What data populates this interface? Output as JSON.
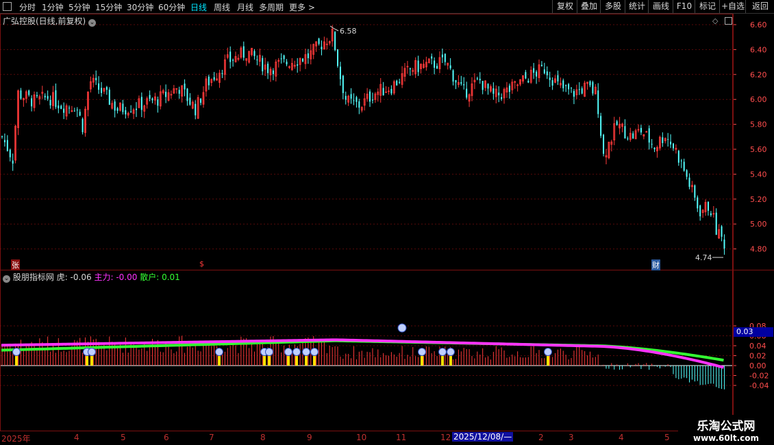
{
  "toolbar": {
    "periods": [
      "分时",
      "1分钟",
      "5分钟",
      "15分钟",
      "30分钟",
      "60分钟",
      "日线",
      "周线",
      "月线",
      "多周期",
      "更多 >"
    ],
    "active_period": "日线",
    "right_buttons": [
      "复权",
      "叠加",
      "多股",
      "统计",
      "画线",
      "F10",
      "标记",
      "+自选",
      "返回"
    ]
  },
  "main_panel": {
    "title": "广弘控股(日线,前复权)",
    "high_label": "6.58",
    "low_label": "4.74",
    "markers": {
      "zhang": "张",
      "dollar": "$",
      "cai": "财"
    },
    "price_ticks": [
      "6.60",
      "6.40",
      "6.20",
      "6.00",
      "5.80",
      "5.60",
      "5.40",
      "5.20",
      "5.00",
      "4.80"
    ]
  },
  "indicator_panel": {
    "name": "股朋指标网",
    "metric1_label": "虎:",
    "metric1_value": "-0.06",
    "metric2_label": "主力:",
    "metric2_value": "-0.00",
    "metric3_label": "散户:",
    "metric3_value": "0.01",
    "ticks": [
      "0.08",
      "0.06",
      "0.04",
      "0.02",
      "0.00",
      "-0.02",
      "-0.04"
    ],
    "current_value_tag": "0.03"
  },
  "date_axis": {
    "labels": [
      "2025年",
      "4",
      "5",
      "6",
      "7",
      "8",
      "9",
      "10",
      "11",
      "12",
      "2025/12/08/—",
      "2",
      "3",
      "4",
      "5"
    ]
  },
  "watermark": {
    "line1": "乐淘公式网",
    "line2": "www.60lt.com"
  },
  "colors": {
    "up": "#ff3a3a",
    "down": "#54ffff",
    "main_force": "#ff33ff",
    "retail": "#33ff33",
    "axis": "#7a1010",
    "axis_text": "#ff4d4d",
    "active": "#00e5ff"
  }
}
